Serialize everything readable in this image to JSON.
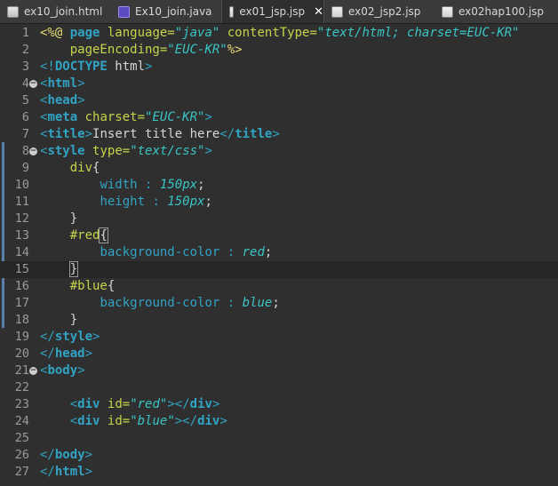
{
  "tabs": [
    {
      "label": "ex10_join.html",
      "icon": "html-file-icon",
      "active": false
    },
    {
      "label": "Ex10_join.java",
      "icon": "java-file-icon",
      "active": false
    },
    {
      "label": "ex01_jsp.jsp",
      "icon": "jsp-file-icon",
      "active": true,
      "close": "✕"
    },
    {
      "label": "ex02_jsp2.jsp",
      "icon": "jsp-file-icon",
      "active": false
    },
    {
      "label": "ex02hap100.jsp",
      "icon": "jsp-file-icon",
      "active": false
    }
  ],
  "current_line": 15,
  "lines": [
    {
      "n": "1",
      "t": [
        [
          "p",
          "<%@ "
        ],
        [
          "b",
          "page "
        ],
        [
          "a",
          "language="
        ],
        [
          "s",
          "\"java\""
        ],
        [
          "c",
          " "
        ],
        [
          "a",
          "contentType="
        ],
        [
          "s",
          "\"text/html; charset=EUC-KR\""
        ]
      ]
    },
    {
      "n": "2",
      "t": [
        [
          "c",
          "    "
        ],
        [
          "a",
          "pageEncoding="
        ],
        [
          "s",
          "\"EUC-KR\""
        ],
        [
          "p",
          "%>"
        ]
      ]
    },
    {
      "n": "3",
      "t": [
        [
          "tg",
          "<!"
        ],
        [
          "b",
          "DOCTYPE"
        ],
        [
          "c",
          " html"
        ],
        [
          "tg",
          ">"
        ]
      ]
    },
    {
      "n": "4",
      "fold": true,
      "t": [
        [
          "tg",
          "<"
        ],
        [
          "b",
          "html"
        ],
        [
          "tg",
          ">"
        ]
      ]
    },
    {
      "n": "5",
      "t": [
        [
          "tg",
          "<"
        ],
        [
          "b",
          "head"
        ],
        [
          "tg",
          ">"
        ]
      ]
    },
    {
      "n": "6",
      "t": [
        [
          "tg",
          "<"
        ],
        [
          "b",
          "meta"
        ],
        [
          "c",
          " "
        ],
        [
          "a",
          "charset="
        ],
        [
          "s",
          "\"EUC-KR\""
        ],
        [
          "tg",
          ">"
        ]
      ]
    },
    {
      "n": "7",
      "t": [
        [
          "tg",
          "<"
        ],
        [
          "b",
          "title"
        ],
        [
          "tg",
          ">"
        ],
        [
          "c",
          "Insert title here"
        ],
        [
          "tg",
          "</"
        ],
        [
          "b",
          "title"
        ],
        [
          "tg",
          ">"
        ]
      ]
    },
    {
      "n": "8",
      "fold": true,
      "t": [
        [
          "tg",
          "<"
        ],
        [
          "b",
          "style"
        ],
        [
          "c",
          " "
        ],
        [
          "a",
          "type="
        ],
        [
          "s",
          "\"text/css\""
        ],
        [
          "tg",
          ">"
        ]
      ]
    },
    {
      "n": "9",
      "t": [
        [
          "c",
          "    "
        ],
        [
          "a",
          "div"
        ],
        [
          "c",
          "{"
        ]
      ]
    },
    {
      "n": "10",
      "t": [
        [
          "c",
          "        "
        ],
        [
          "tg",
          "width"
        ],
        [
          "c",
          " "
        ],
        [
          "tg",
          ":"
        ],
        [
          "c",
          " "
        ],
        [
          "s",
          "150px"
        ],
        [
          "c",
          ";"
        ]
      ]
    },
    {
      "n": "11",
      "t": [
        [
          "c",
          "        "
        ],
        [
          "tg",
          "height"
        ],
        [
          "c",
          " "
        ],
        [
          "tg",
          ":"
        ],
        [
          "c",
          " "
        ],
        [
          "s",
          "150px"
        ],
        [
          "c",
          ";"
        ]
      ]
    },
    {
      "n": "12",
      "t": [
        [
          "c",
          "    }"
        ]
      ]
    },
    {
      "n": "13",
      "t": [
        [
          "c",
          "    "
        ],
        [
          "a",
          "#red"
        ],
        [
          "h",
          "{"
        ]
      ]
    },
    {
      "n": "14",
      "t": [
        [
          "c",
          "        "
        ],
        [
          "tg",
          "background-color"
        ],
        [
          "c",
          " "
        ],
        [
          "tg",
          ":"
        ],
        [
          "c",
          " "
        ],
        [
          "s",
          "red"
        ],
        [
          "c",
          ";"
        ]
      ]
    },
    {
      "n": "15",
      "t": [
        [
          "c",
          "    "
        ],
        [
          "h",
          "}"
        ],
        [
          "k",
          ""
        ]
      ]
    },
    {
      "n": "16",
      "t": [
        [
          "c",
          "    "
        ],
        [
          "a",
          "#blue"
        ],
        [
          "c",
          "{"
        ]
      ]
    },
    {
      "n": "17",
      "t": [
        [
          "c",
          "        "
        ],
        [
          "tg",
          "background-color"
        ],
        [
          "c",
          " "
        ],
        [
          "tg",
          ":"
        ],
        [
          "c",
          " "
        ],
        [
          "s",
          "blue"
        ],
        [
          "c",
          ";"
        ]
      ]
    },
    {
      "n": "18",
      "t": [
        [
          "c",
          "    }"
        ]
      ]
    },
    {
      "n": "19",
      "t": [
        [
          "tg",
          "</"
        ],
        [
          "b",
          "style"
        ],
        [
          "tg",
          ">"
        ]
      ]
    },
    {
      "n": "20",
      "t": [
        [
          "tg",
          "</"
        ],
        [
          "b",
          "head"
        ],
        [
          "tg",
          ">"
        ]
      ]
    },
    {
      "n": "21",
      "fold": true,
      "t": [
        [
          "tg",
          "<"
        ],
        [
          "b",
          "body"
        ],
        [
          "tg",
          ">"
        ]
      ]
    },
    {
      "n": "22",
      "t": []
    },
    {
      "n": "23",
      "t": [
        [
          "c",
          "    "
        ],
        [
          "tg",
          "<"
        ],
        [
          "b",
          "div"
        ],
        [
          "c",
          " "
        ],
        [
          "a",
          "id="
        ],
        [
          "s",
          "\"red\""
        ],
        [
          "tg",
          "></"
        ],
        [
          "b",
          "div"
        ],
        [
          "tg",
          ">"
        ]
      ]
    },
    {
      "n": "24",
      "t": [
        [
          "c",
          "    "
        ],
        [
          "tg",
          "<"
        ],
        [
          "b",
          "div"
        ],
        [
          "c",
          " "
        ],
        [
          "a",
          "id="
        ],
        [
          "s",
          "\"blue\""
        ],
        [
          "tg",
          "></"
        ],
        [
          "b",
          "div"
        ],
        [
          "tg",
          ">"
        ]
      ]
    },
    {
      "n": "25",
      "t": []
    },
    {
      "n": "26",
      "t": [
        [
          "tg",
          "</"
        ],
        [
          "b",
          "body"
        ],
        [
          "tg",
          ">"
        ]
      ]
    },
    {
      "n": "27",
      "t": [
        [
          "tg",
          "</"
        ],
        [
          "b",
          "html"
        ],
        [
          "tg",
          ">"
        ]
      ]
    }
  ]
}
